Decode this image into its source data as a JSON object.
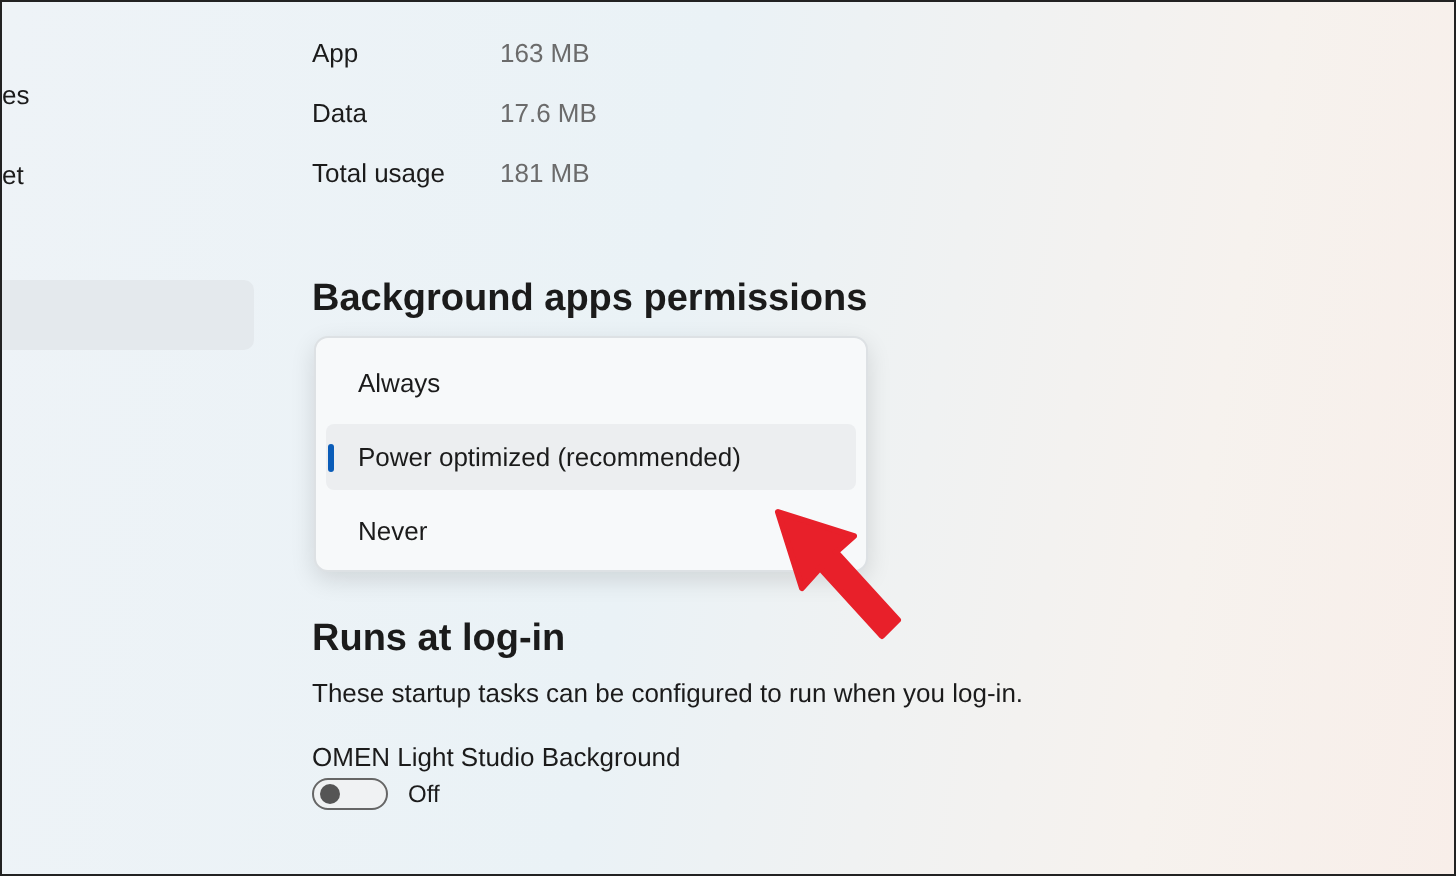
{
  "sidebar": {
    "items": [
      {
        "label": "es",
        "selected": false
      },
      {
        "label": "et",
        "selected": false
      },
      {
        "selected": true
      }
    ]
  },
  "usage": [
    {
      "label": "App",
      "value": "163 MB"
    },
    {
      "label": "Data",
      "value": "17.6 MB"
    },
    {
      "label": "Total usage",
      "value": "181 MB"
    }
  ],
  "background_permissions": {
    "title": "Background apps permissions",
    "options": [
      {
        "label": "Always",
        "selected": false
      },
      {
        "label": "Power optimized (recommended)",
        "selected": true
      },
      {
        "label": "Never",
        "selected": false
      }
    ]
  },
  "runs_at_login": {
    "title": "Runs at log-in",
    "description": "These startup tasks can be configured to run when you log-in.",
    "tasks": [
      {
        "name": "OMEN Light Studio Background",
        "on": false,
        "state_label": "Off"
      }
    ]
  }
}
